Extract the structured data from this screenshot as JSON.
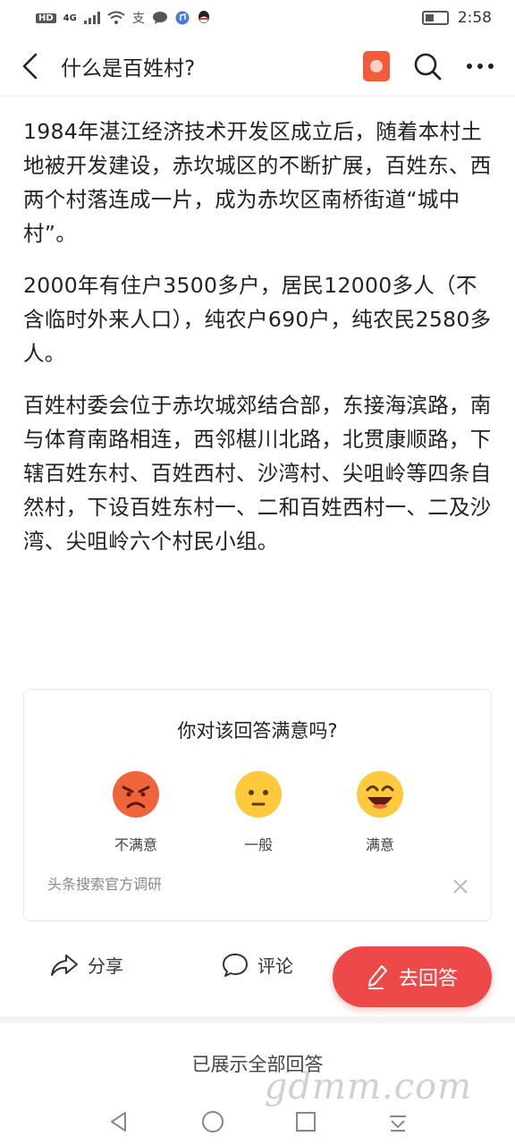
{
  "status_bar": {
    "left_badges": [
      "HD",
      "4G"
    ],
    "time": "2:58",
    "icons": [
      "signal-icon",
      "wifi-icon",
      "alipay-icon",
      "chat-icon",
      "music-icon",
      "qq-icon",
      "battery-icon"
    ]
  },
  "header": {
    "title": "什么是百姓村?",
    "icons": [
      "back-icon",
      "app-icon",
      "search-icon",
      "more-icon"
    ]
  },
  "article": {
    "paragraphs": [
      "1984年湛江经济技术开发区成立后，随着本村土地被开发建设，赤坎城区的不断扩展，百姓东、西两个村落连成一片，成为赤坎区南桥街道“城中村”。",
      "2000年有住户3500多户，居民12000多人（不含临时外来人口），纯农户690户，纯农民2580多人。",
      "百姓村委会位于赤坎城郊结合部，东接海滨路，南与体育南路相连，西邻椹川北路，北贯康顺路，下辖百姓东村、百姓西村、沙湾村、尖咀岭等四条自然村，下设百姓东村一、二和百姓西村一、二及沙湾、尖咀岭六个村民小组。"
    ]
  },
  "survey": {
    "question": "你对该回答满意吗?",
    "options": [
      {
        "label": "不满意",
        "icon": "angry-face-icon"
      },
      {
        "label": "一般",
        "icon": "neutral-face-icon"
      },
      {
        "label": "满意",
        "icon": "happy-face-icon"
      }
    ],
    "source": "头条搜索官方调研",
    "colors": {
      "angry": "#f0643c",
      "neutral": "#ffc83d",
      "happy": "#ffc83d"
    }
  },
  "actions": {
    "share_label": "分享",
    "comment_label": "评论",
    "answer_label": "去回答",
    "answer_color": "#ed4949"
  },
  "footer": {
    "note": "已展示全部回答",
    "watermark": "gdmm.com"
  }
}
